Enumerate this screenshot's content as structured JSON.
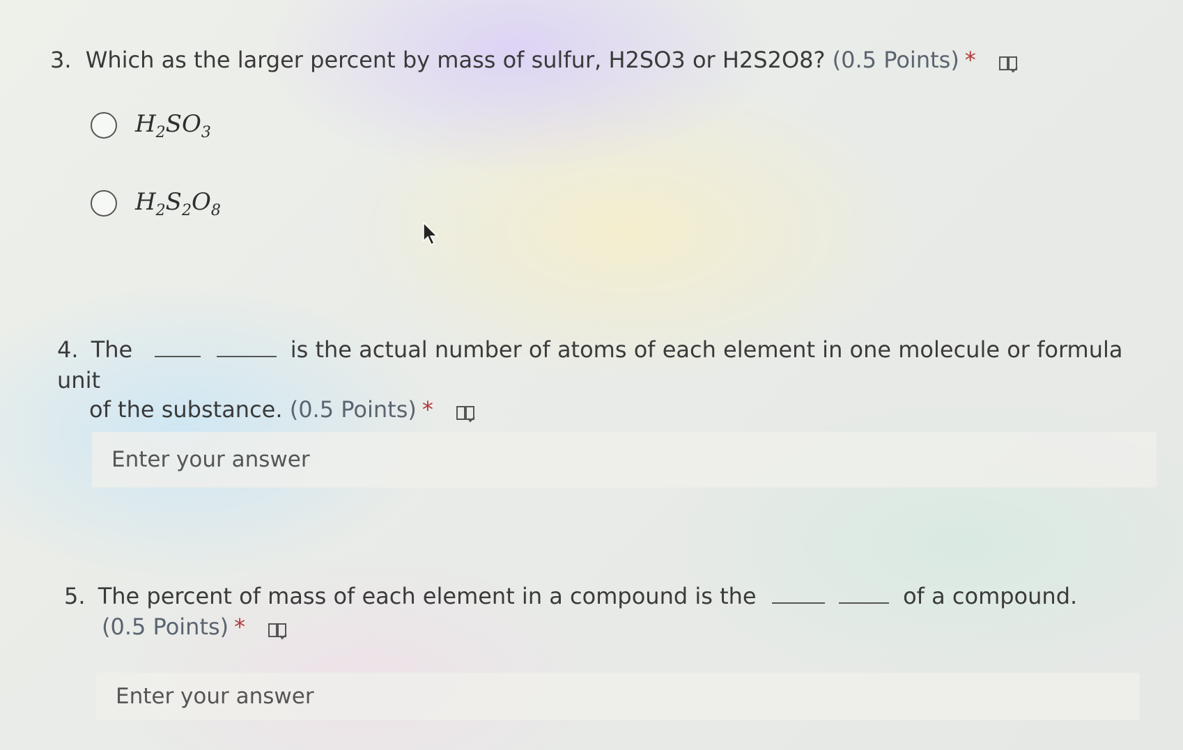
{
  "q3": {
    "number": "3.",
    "text": "Which as the larger percent by mass of sulfur, H2SO3 or H2S2O8?",
    "points": "(0.5 Points)",
    "required": "*",
    "options": [
      {
        "base1": "H",
        "sub1": "2",
        "base2": "SO",
        "sub2": "3"
      },
      {
        "base1": "H",
        "sub1": "2",
        "base2": "S",
        "sub2": "2",
        "base3": "O",
        "sub3": "8"
      }
    ]
  },
  "q4": {
    "number": "4.",
    "text_before": "The",
    "text_after": "is the actual number of atoms of each element in one molecule or formula unit",
    "text_line2": "of the substance.",
    "points": "(0.5 Points)",
    "required": "*",
    "answer_placeholder": "Enter your answer"
  },
  "q5": {
    "number": "5.",
    "text_before": "The percent of mass of each element in a compound is the",
    "text_after": "of a compound.",
    "points": "(0.5 Points)",
    "required": "*",
    "answer_placeholder": "Enter your answer"
  },
  "icons": {
    "reader": "immersive-reader-icon",
    "pointer": "mouse-pointer-icon"
  }
}
